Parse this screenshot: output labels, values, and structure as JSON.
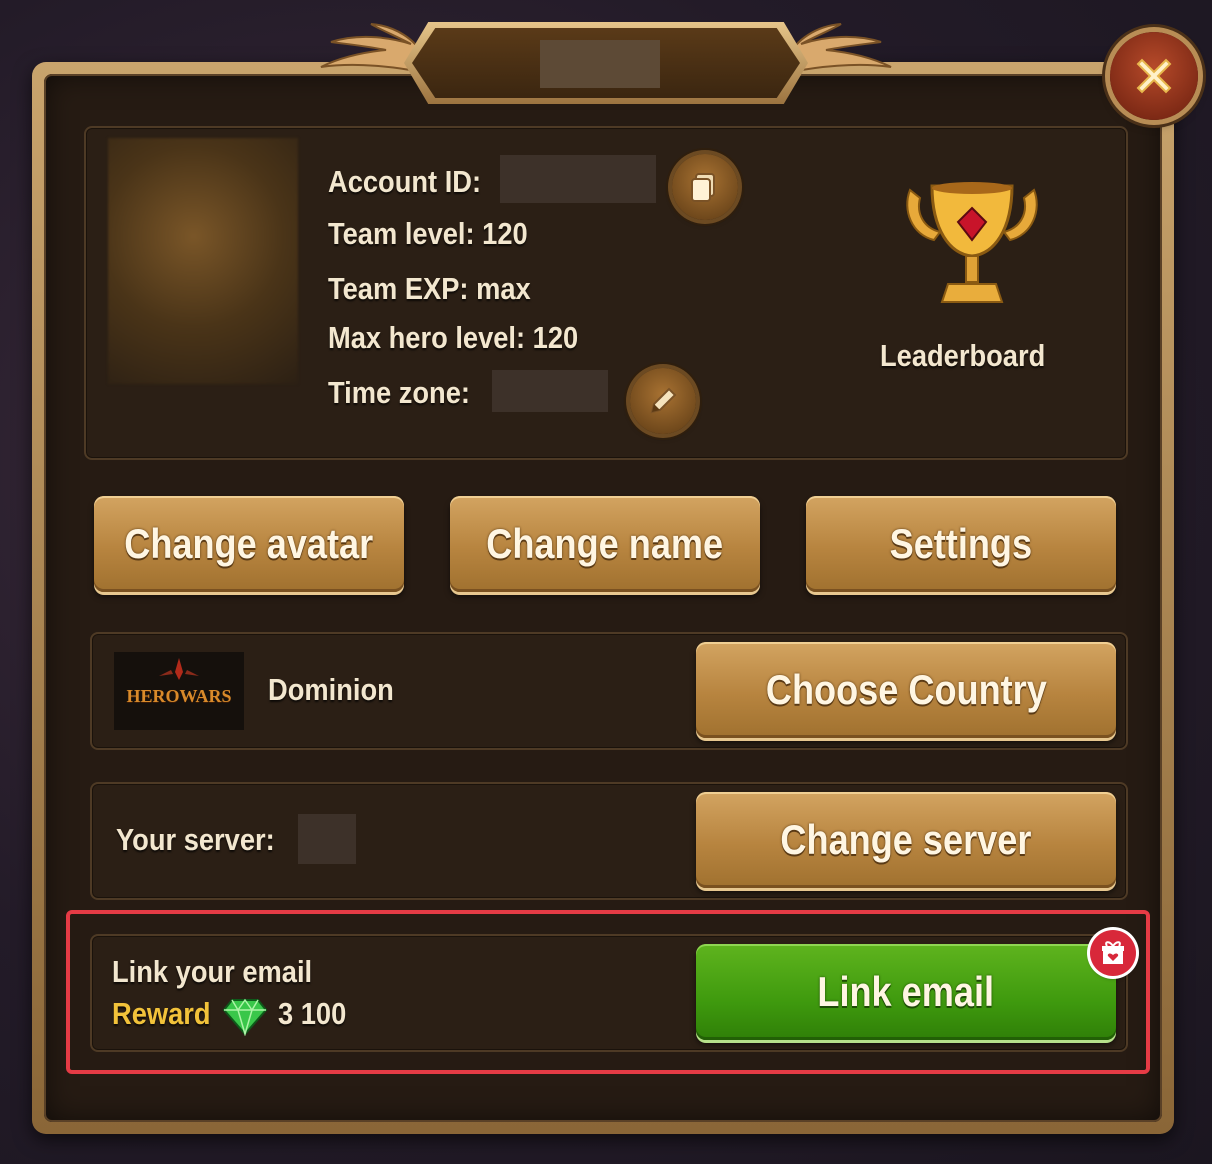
{
  "profile": {
    "account_id_label": "Account ID:",
    "team_level_label": "Team level: 120",
    "team_exp_label": "Team EXP: max",
    "max_hero_level_label": "Max hero level: 120",
    "time_zone_label": "Time zone:"
  },
  "leaderboard": {
    "label": "Leaderboard"
  },
  "actions": {
    "change_avatar": "Change avatar",
    "change_name": "Change name",
    "settings": "Settings"
  },
  "country": {
    "logo_text": "HEROWARS",
    "name": "Dominion",
    "button": "Choose Country"
  },
  "server": {
    "label": "Your server:",
    "button": "Change server"
  },
  "email": {
    "title": "Link your email",
    "reward_label": "Reward",
    "reward_amount": "3 100",
    "button": "Link email"
  },
  "colors": {
    "gold_button": "#b7843f",
    "green_button": "#3f9a0e",
    "highlight": "#e53b45",
    "reward_text": "#f2c23a"
  },
  "icons": [
    "close-icon",
    "copy-icon",
    "edit-pencil-icon",
    "trophy-icon",
    "gem-icon",
    "gift-icon"
  ]
}
